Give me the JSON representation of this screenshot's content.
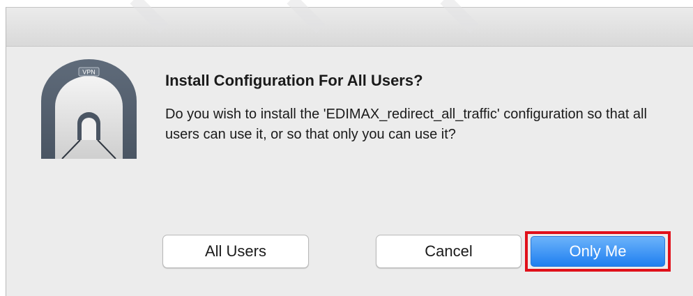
{
  "dialog": {
    "title": "Install Configuration For All Users?",
    "message": "Do you wish to install the 'EDIMAX_redirect_all_traffic' configuration so that all users can use it, or so that only you can use it?",
    "icon": "vpn-tunnel-icon",
    "icon_label": "VPN"
  },
  "buttons": {
    "all_users": "All Users",
    "cancel": "Cancel",
    "only_me": "Only Me"
  },
  "colors": {
    "highlight_border": "#e0101a",
    "default_button": "#1f7ff0",
    "dialog_background": "#ececec"
  }
}
